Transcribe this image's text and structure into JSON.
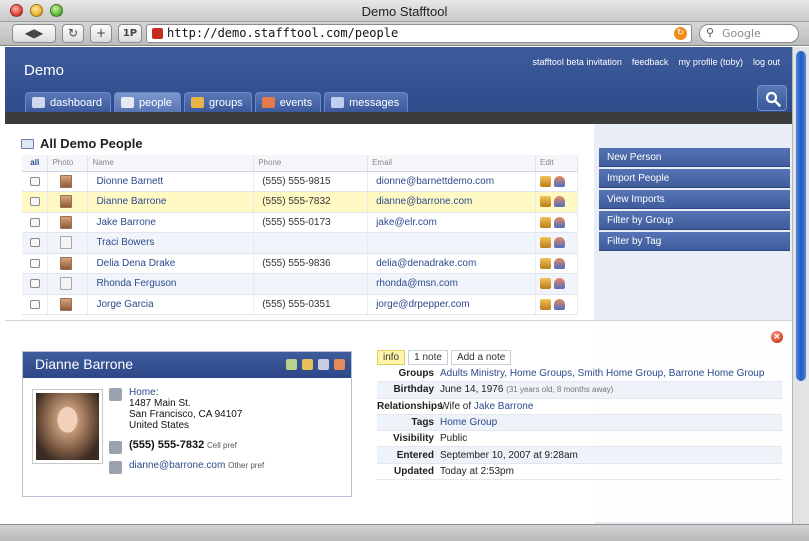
{
  "window": {
    "title": "Demo Stafftool"
  },
  "toolbar": {
    "url": "http://demo.stafftool.com/people",
    "search_placeholder": "Google",
    "back_forward": "◀▶",
    "reload": "↻",
    "add": "+",
    "onepass": "1P"
  },
  "app": {
    "name": "Demo",
    "top_links": [
      "stafftool beta invitation",
      "feedback",
      "my profile (toby)",
      "log out"
    ],
    "tabs": [
      {
        "label": "dashboard",
        "icon_color": "#cfd9ee"
      },
      {
        "label": "people",
        "icon_color": "#e6e9f2"
      },
      {
        "label": "groups",
        "icon_color": "#e8b44a"
      },
      {
        "label": "events",
        "icon_color": "#e47a4a"
      },
      {
        "label": "messages",
        "icon_color": "#bfd0ef"
      }
    ]
  },
  "people": {
    "title": "All Demo People",
    "columns": [
      "all",
      "Photo",
      "Name",
      "Phone",
      "Email",
      "Edit"
    ],
    "rows": [
      {
        "name": "Dionne Barnett",
        "phone": "(555) 555-9815",
        "email": "dionne@barnettdemo.com",
        "photo": "real"
      },
      {
        "name": "Dianne Barrone",
        "phone": "(555) 555-7832",
        "email": "dianne@barrone.com",
        "photo": "real",
        "highlight": true
      },
      {
        "name": "Jake Barrone",
        "phone": "(555) 555-0173",
        "email": "jake@elr.com",
        "photo": "real"
      },
      {
        "name": "Traci Bowers",
        "phone": "",
        "email": "",
        "photo": "blank"
      },
      {
        "name": "Delia Dena Drake",
        "phone": "(555) 555-9836",
        "email": "delia@denadrake.com",
        "photo": "real"
      },
      {
        "name": "Rhonda Ferguson",
        "phone": "",
        "email": "rhonda@msn.com",
        "photo": "blank"
      },
      {
        "name": "Jorge Garcia",
        "phone": "(555) 555-0351",
        "email": "jorge@drpepper.com",
        "photo": "real"
      }
    ]
  },
  "sidebar": {
    "buttons": [
      "New Person",
      "Import People",
      "View Imports",
      "Filter by Group",
      "Filter by Tag"
    ]
  },
  "detail": {
    "name": "Dianne Barrone",
    "address_label": "Home",
    "address_lines": [
      "1487 Main St.",
      "San Francisco, CA 94107",
      "United States"
    ],
    "phone": "(555) 555-7832",
    "phone_pref": "Cell pref",
    "email": "dianne@barrone.com",
    "email_pref": "Other pref",
    "info_tabs": [
      "info",
      "1 note",
      "Add a note"
    ],
    "fields": {
      "groups_key": "Groups",
      "groups_value": "Adults Ministry, Home Groups, Smith Home Group, Barrone Home Group",
      "birthday_key": "Birthday",
      "birthday_value": "June 14, 1976",
      "birthday_sub": "(31 years old, 8 months away)",
      "relationships_key": "Relationships",
      "relationships_prefix": "Wife of ",
      "relationships_link": "Jake Barrone",
      "tags_key": "Tags",
      "tags_value": "Home Group",
      "visibility_key": "Visibility",
      "visibility_value": "Public",
      "entered_key": "Entered",
      "entered_value": "September 10, 2007 at 9:28am",
      "updated_key": "Updated",
      "updated_value": "Today at 2:53pm"
    }
  },
  "colors": {
    "brand": "#3e5b9c",
    "highlight": "#fff9c4",
    "link": "#2c4a8d"
  }
}
